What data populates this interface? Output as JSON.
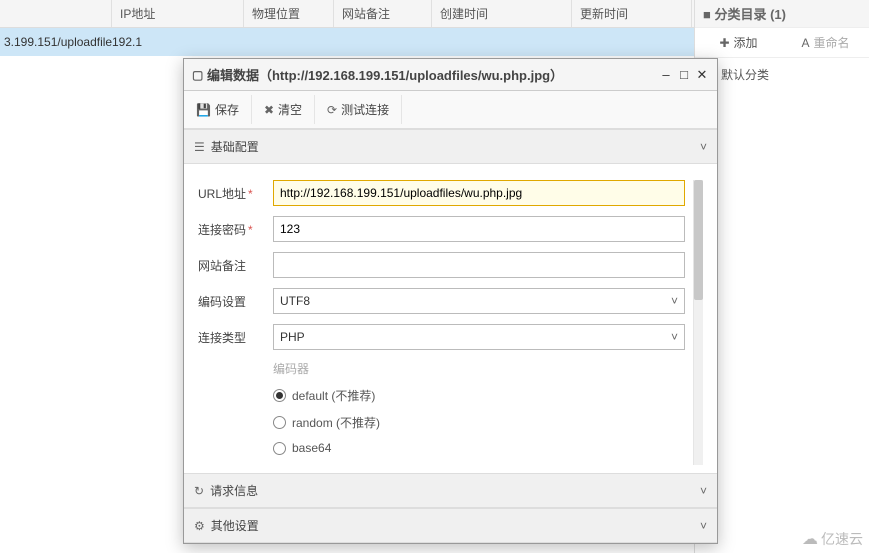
{
  "table": {
    "headers": {
      "ip": "IP地址",
      "loc": "物理位置",
      "note": "网站备注",
      "created": "创建时间",
      "updated": "更新时间"
    },
    "row": {
      "c1": "3.199.151/uploadfile",
      "c2": "192.1"
    }
  },
  "sidebar": {
    "title": "■ 分类目录 (1)",
    "add_label": "添加",
    "rename_label": "重命名",
    "default_folder": "默认分类"
  },
  "dialog": {
    "title": "编辑数据（http://192.168.199.151/uploadfiles/wu.php.jpg）",
    "toolbar": {
      "save": "保存",
      "clear": "清空",
      "test": "测试连接"
    },
    "sections": {
      "basic": "基础配置",
      "request": "请求信息",
      "other": "其他设置"
    },
    "form": {
      "url_label": "URL地址",
      "url_value": "http://192.168.199.151/uploadfiles/wu.php.jpg",
      "pwd_label": "连接密码",
      "pwd_value": "123",
      "note_label": "网站备注",
      "note_value": "",
      "enc_label": "编码设置",
      "enc_value": "UTF8",
      "type_label": "连接类型",
      "type_value": "PHP",
      "encoder_title": "编码器",
      "encoders": {
        "default": "default (不推荐)",
        "random": "random (不推荐)",
        "base64": "base64"
      }
    }
  },
  "watermark": "亿速云"
}
